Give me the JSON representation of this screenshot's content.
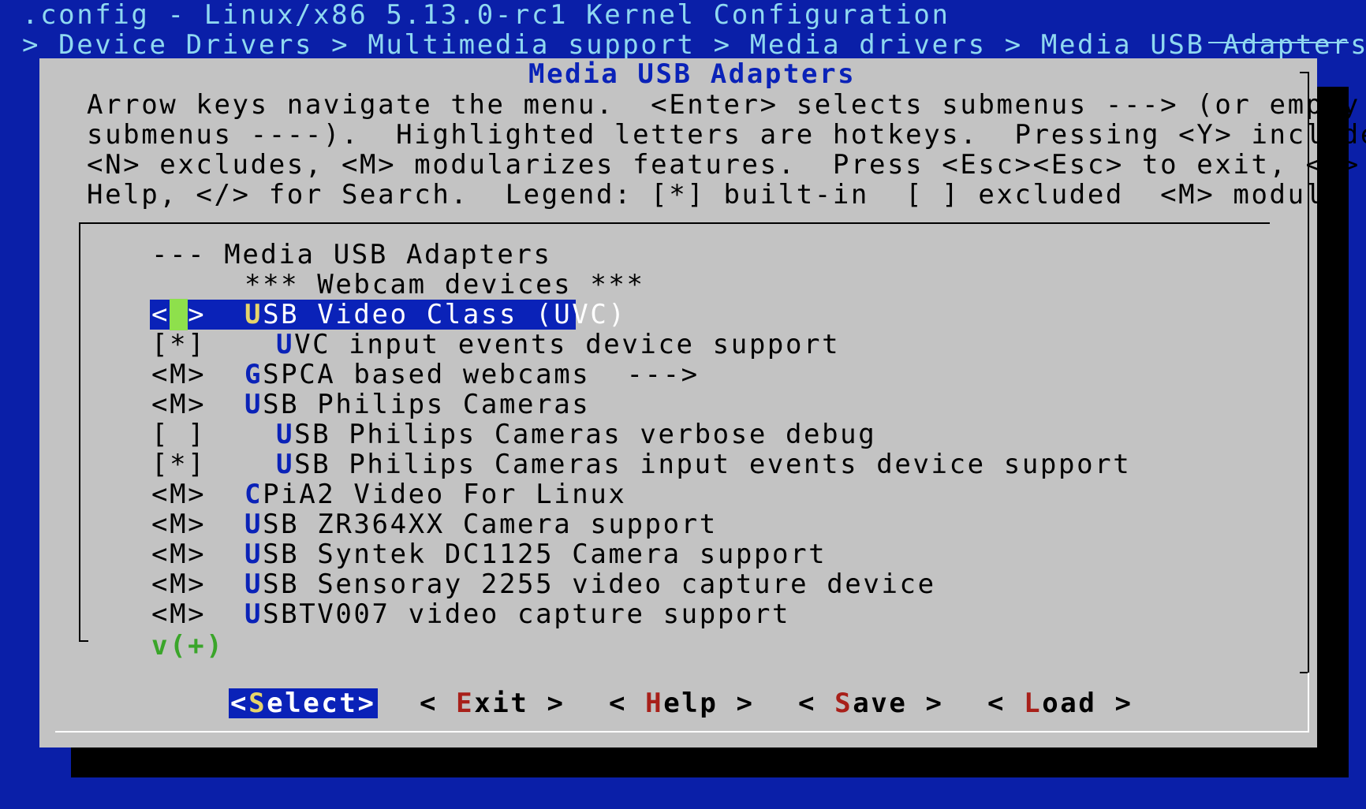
{
  "window": {
    "title": ".config - Linux/x86 5.13.0-rc1 Kernel Configuration",
    "breadcrumb": "> Device Drivers > Multimedia support > Media drivers > Media USB Adapters"
  },
  "dialog": {
    "title": "Media USB Adapters",
    "help_lines": [
      "Arrow keys navigate the menu.  <Enter> selects submenus ---> (or empty",
      "submenus ----).  Highlighted letters are hotkeys.  Pressing <Y> includes,",
      "<N> excludes, <M> modularizes features.  Press <Esc><Esc> to exit, <?> for",
      "Help, </> for Search.  Legend: [*] built-in  [ ] excluded  <M> module  < >"
    ]
  },
  "menu": {
    "header": "--- Media USB Adapters",
    "comment": "*** Webcam devices ***",
    "items": [
      {
        "state": "< >",
        "hotkey": "U",
        "rest": "SB Video Class (UVC)",
        "indent": 0,
        "selected": true
      },
      {
        "state": "[*]",
        "hotkey": "U",
        "rest": "VC input events device support",
        "indent": 1
      },
      {
        "state": "<M>",
        "hotkey": "G",
        "rest": "SPCA based webcams  --->",
        "indent": 0
      },
      {
        "state": "<M>",
        "hotkey": "U",
        "rest": "SB Philips Cameras",
        "indent": 0
      },
      {
        "state": "[ ]",
        "hotkey": "U",
        "rest": "SB Philips Cameras verbose debug",
        "indent": 1
      },
      {
        "state": "[*]",
        "hotkey": "U",
        "rest": "SB Philips Cameras input events device support",
        "indent": 1
      },
      {
        "state": "<M>",
        "hotkey": "C",
        "rest": "PiA2 Video For Linux",
        "indent": 0
      },
      {
        "state": "<M>",
        "hotkey": "U",
        "rest": "SB ZR364XX Camera support",
        "indent": 0
      },
      {
        "state": "<M>",
        "hotkey": "U",
        "rest": "SB Syntek DC1125 Camera support",
        "indent": 0
      },
      {
        "state": "<M>",
        "hotkey": "U",
        "rest": "SB Sensoray 2255 video capture device",
        "indent": 0
      },
      {
        "state": "<M>",
        "hotkey": "U",
        "rest": "SBTV007 video capture support",
        "indent": 0
      }
    ],
    "more_indicator": "v(+)"
  },
  "buttons": {
    "select": {
      "pre": "<",
      "key": "S",
      "post": "elect>"
    },
    "exit": {
      "pre": "< ",
      "key": "E",
      "post": "xit >"
    },
    "help": {
      "pre": "< ",
      "key": "H",
      "post": "elp >"
    },
    "save": {
      "pre": "< ",
      "key": "S",
      "post": "ave >"
    },
    "load": {
      "pre": "< ",
      "key": "L",
      "post": "oad >"
    }
  },
  "colors": {
    "background": "#0a1fa8",
    "dialog": "#c3c3c3",
    "highlight": "#0a22b8",
    "hotkey_selected": "#e6d46a",
    "button_hotkey": "#a8201a",
    "cursor": "#8ee04c"
  }
}
